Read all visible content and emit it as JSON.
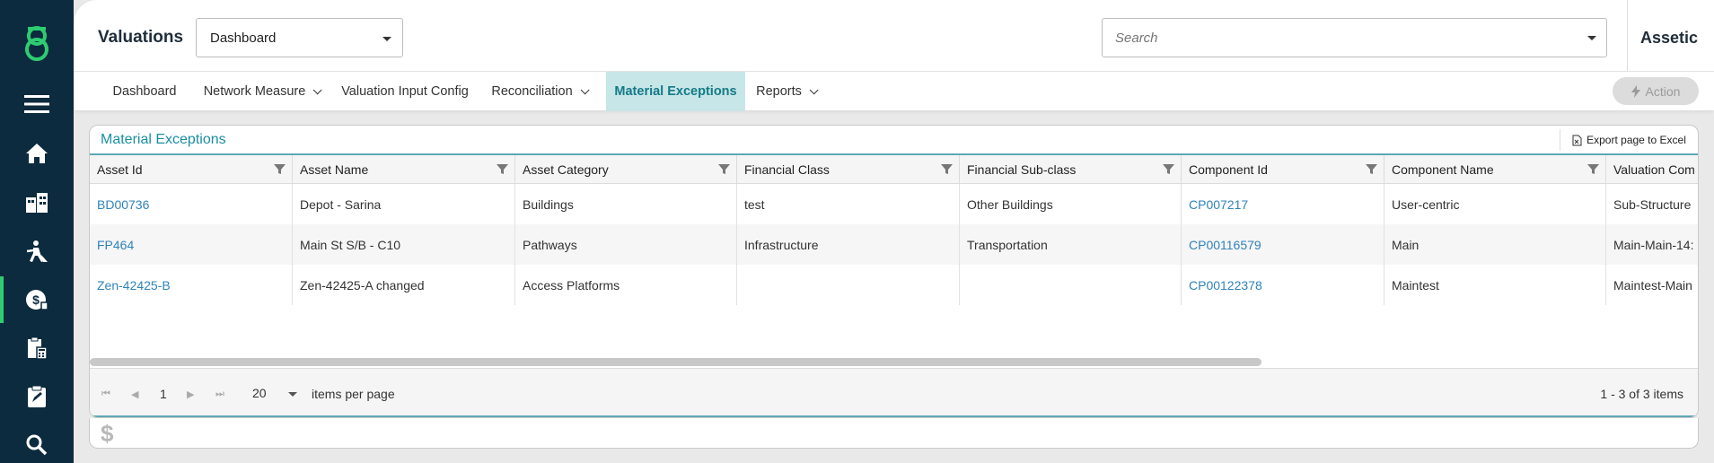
{
  "nav": {
    "items": [
      {
        "icon": "logo-icon"
      },
      {
        "icon": "menu-icon"
      },
      {
        "icon": "home-icon"
      },
      {
        "icon": "buildings-icon"
      },
      {
        "icon": "worker-icon"
      },
      {
        "icon": "valuation-icon",
        "active": true
      },
      {
        "icon": "clipboard-calc-icon"
      },
      {
        "icon": "clipboard-edit-icon"
      },
      {
        "icon": "search-icon"
      }
    ],
    "accent_color": "#2ecc71",
    "background": "#0c2b3e"
  },
  "header": {
    "title": "Valuations",
    "view_select": "Dashboard",
    "search_placeholder": "Search",
    "brand": "Assetic"
  },
  "subnav": {
    "tabs": [
      {
        "label": "Dashboard",
        "has_dropdown": false
      },
      {
        "label": "Network Measure",
        "has_dropdown": true
      },
      {
        "label": "Valuation Input Config",
        "has_dropdown": false
      },
      {
        "label": "Reconciliation",
        "has_dropdown": true
      },
      {
        "label": "Material Exceptions",
        "has_dropdown": false,
        "active": true
      },
      {
        "label": "Reports",
        "has_dropdown": true
      }
    ],
    "action_label": "Action"
  },
  "grid": {
    "title": "Material Exceptions",
    "export_label": "Export page to Excel",
    "columns": [
      "Asset Id",
      "Asset Name",
      "Asset Category",
      "Financial Class",
      "Financial Sub-class",
      "Component Id",
      "Component Name",
      "Valuation Com"
    ],
    "rows": [
      [
        "BD00736",
        "Depot - Sarina",
        "Buildings",
        "test",
        "Other Buildings",
        "CP007217",
        "User-centric",
        "Sub-Structure"
      ],
      [
        "FP464",
        "Main St S/B - C10",
        "Pathways",
        "Infrastructure",
        "Transportation",
        "CP00116579",
        "Main",
        "Main-Main-14:"
      ],
      [
        "Zen-42425-B",
        "Zen-42425-A changed",
        "Access Platforms",
        "",
        "",
        "CP00122378",
        "Maintest",
        "Maintest-Main"
      ]
    ],
    "pager": {
      "page": "1",
      "page_size": "20",
      "page_size_label": "items per page",
      "info": "1 - 3 of 3 items"
    }
  },
  "panel2": {
    "symbol": "$"
  }
}
